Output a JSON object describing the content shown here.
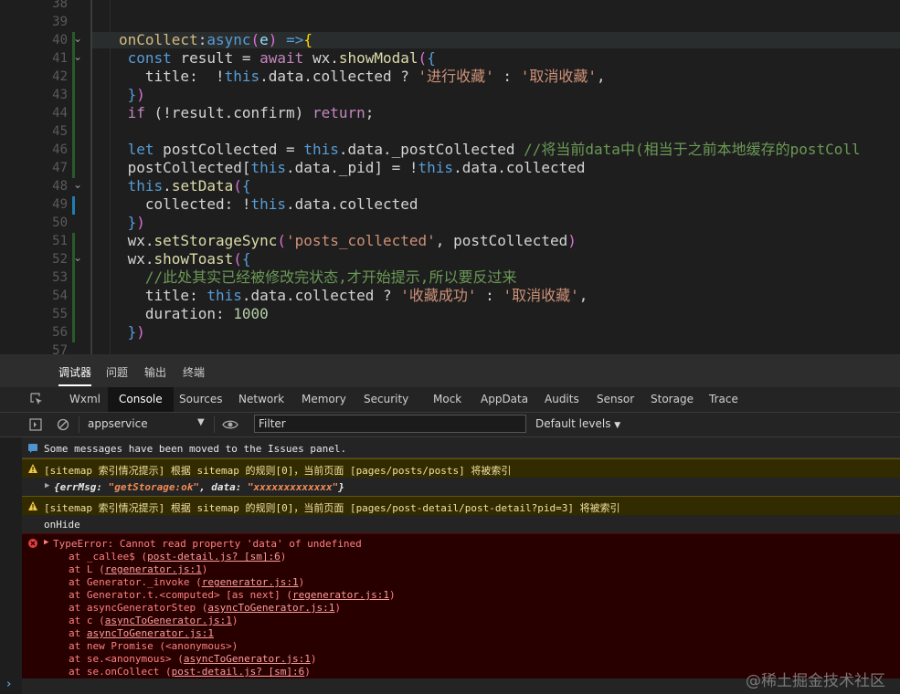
{
  "editor": {
    "lines": [
      {
        "num": "38",
        "tokens": []
      },
      {
        "num": "39",
        "tokens": []
      },
      {
        "num": "40",
        "fold": true,
        "tokens": [
          [
            "prop",
            "onCollect"
          ],
          [
            "plain",
            ":"
          ],
          [
            "kw",
            "async"
          ],
          [
            "brace2",
            "("
          ],
          [
            "param",
            "e"
          ],
          [
            "brace2",
            ")"
          ],
          [
            "plain",
            " "
          ],
          [
            "kw",
            "=>"
          ],
          [
            "brace",
            "{"
          ]
        ]
      },
      {
        "num": "41",
        "fold": true,
        "tokens": [
          [
            "plain",
            " "
          ],
          [
            "kw",
            "const"
          ],
          [
            "plain",
            " result = "
          ],
          [
            "ctrl",
            "await"
          ],
          [
            "plain",
            " wx."
          ],
          [
            "fn",
            "showModal"
          ],
          [
            "brace2",
            "("
          ],
          [
            "kw",
            "{"
          ]
        ]
      },
      {
        "num": "42",
        "tokens": [
          [
            "plain",
            "   title:  !"
          ],
          [
            "kw",
            "this"
          ],
          [
            "plain",
            ".data.collected ? "
          ],
          [
            "str",
            "'进行收藏'"
          ],
          [
            "plain",
            " : "
          ],
          [
            "str",
            "'取消收藏'"
          ],
          [
            "plain",
            ","
          ]
        ]
      },
      {
        "num": "43",
        "tokens": [
          [
            "plain",
            " "
          ],
          [
            "kw",
            "}"
          ],
          [
            "brace2",
            ")"
          ]
        ]
      },
      {
        "num": "44",
        "tokens": [
          [
            "plain",
            " "
          ],
          [
            "ctrl",
            "if"
          ],
          [
            "plain",
            " (!result.confirm) "
          ],
          [
            "ctrl",
            "return"
          ],
          [
            "plain",
            ";"
          ]
        ]
      },
      {
        "num": "45",
        "tokens": []
      },
      {
        "num": "46",
        "tokens": [
          [
            "plain",
            " "
          ],
          [
            "kw",
            "let"
          ],
          [
            "plain",
            " postCollected = "
          ],
          [
            "kw",
            "this"
          ],
          [
            "plain",
            ".data._postCollected "
          ],
          [
            "cmt",
            "//将当前data中(相当于之前本地缓存的postColl"
          ]
        ]
      },
      {
        "num": "47",
        "tokens": [
          [
            "plain",
            " postCollected["
          ],
          [
            "kw",
            "this"
          ],
          [
            "plain",
            ".data._pid] = !"
          ],
          [
            "kw",
            "this"
          ],
          [
            "plain",
            ".data.collected"
          ]
        ]
      },
      {
        "num": "48",
        "fold": true,
        "tokens": [
          [
            "plain",
            " "
          ],
          [
            "kw",
            "this"
          ],
          [
            "plain",
            "."
          ],
          [
            "fn",
            "setData"
          ],
          [
            "brace2",
            "("
          ],
          [
            "kw",
            "{"
          ]
        ]
      },
      {
        "num": "49",
        "tokens": [
          [
            "plain",
            "   collected: !"
          ],
          [
            "kw",
            "this"
          ],
          [
            "plain",
            ".data.collected"
          ]
        ]
      },
      {
        "num": "50",
        "tokens": [
          [
            "plain",
            " "
          ],
          [
            "kw",
            "}"
          ],
          [
            "brace2",
            ")"
          ]
        ]
      },
      {
        "num": "51",
        "tokens": [
          [
            "plain",
            " wx."
          ],
          [
            "fn",
            "setStorageSync"
          ],
          [
            "brace2",
            "("
          ],
          [
            "str",
            "'posts_collected'"
          ],
          [
            "plain",
            ", postCollected"
          ],
          [
            "brace2",
            ")"
          ]
        ]
      },
      {
        "num": "52",
        "fold": true,
        "tokens": [
          [
            "plain",
            " wx."
          ],
          [
            "fn",
            "showToast"
          ],
          [
            "brace2",
            "("
          ],
          [
            "kw",
            "{"
          ]
        ]
      },
      {
        "num": "53",
        "tokens": [
          [
            "plain",
            "   "
          ],
          [
            "cmt",
            "//此处其实已经被修改完状态,才开始提示,所以要反过来"
          ]
        ]
      },
      {
        "num": "54",
        "tokens": [
          [
            "plain",
            "   title: "
          ],
          [
            "kw",
            "this"
          ],
          [
            "plain",
            ".data.collected ? "
          ],
          [
            "str",
            "'收藏成功'"
          ],
          [
            "plain",
            " : "
          ],
          [
            "str",
            "'取消收藏'"
          ],
          [
            "plain",
            ","
          ]
        ]
      },
      {
        "num": "55",
        "tokens": [
          [
            "plain",
            "   duration: "
          ],
          [
            "num",
            "1000"
          ]
        ]
      },
      {
        "num": "56",
        "tokens": [
          [
            "plain",
            " "
          ],
          [
            "kw",
            "}"
          ],
          [
            "brace2",
            ")"
          ]
        ]
      },
      {
        "num": "57",
        "tokens": []
      }
    ]
  },
  "panel_tabs": [
    "调试器",
    "问题",
    "输出",
    "终端"
  ],
  "tool_tabs": [
    "Wxml",
    "Console",
    "Sources",
    "Network",
    "Memory",
    "Security",
    "Mock",
    "AppData",
    "Audits",
    "Sensor",
    "Storage",
    "Trace"
  ],
  "filter_bar": {
    "context": "appservice",
    "filter_placeholder": "Filter",
    "levels": "Default levels"
  },
  "console": {
    "info": "Some messages have been moved to the Issues panel.",
    "warn1": "[sitemap 索引情况提示] 根据 sitemap 的规则[0]，当前页面 [pages/posts/posts] 将被索引",
    "obj": {
      "k1": "errMsg: ",
      "v1": "\"getStorage:ok\"",
      "k2": ", data: ",
      "v2": "\"xxxxxxxxxxxxx\""
    },
    "warn2": "[sitemap 索引情况提示] 根据 sitemap 的规则[0]，当前页面 [pages/post-detail/post-detail?pid=3] 将被索引",
    "plain": "onHide",
    "error_title": "TypeError: Cannot read property 'data' of undefined",
    "stack": [
      {
        "pre": "at _callee$ (",
        "link": "post-detail.js? [sm]:6",
        "post": ")"
      },
      {
        "pre": "at L (",
        "link": "regenerator.js:1",
        "post": ")"
      },
      {
        "pre": "at Generator._invoke (",
        "link": "regenerator.js:1",
        "post": ")"
      },
      {
        "pre": "at Generator.t.<computed> [as next] (",
        "link": "regenerator.js:1",
        "post": ")"
      },
      {
        "pre": "at asyncGeneratorStep (",
        "link": "asyncToGenerator.js:1",
        "post": ")"
      },
      {
        "pre": "at c (",
        "link": "asyncToGenerator.js:1",
        "post": ")"
      },
      {
        "pre": "at ",
        "link": "asyncToGenerator.js:1",
        "post": ""
      },
      {
        "pre": "at new Promise (<anonymous>)",
        "link": "",
        "post": ""
      },
      {
        "pre": "at se.<anonymous> (",
        "link": "asyncToGenerator.js:1",
        "post": ")"
      },
      {
        "pre": "at se.onCollect (",
        "link": "post-detail.js? [sm]:6",
        "post": ")"
      }
    ]
  },
  "watermark": "@稀土掘金技术社区"
}
